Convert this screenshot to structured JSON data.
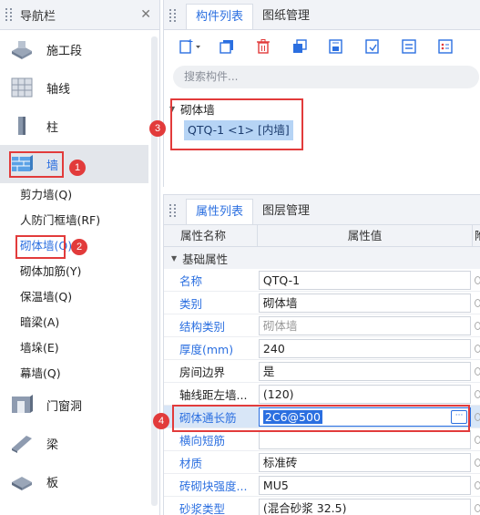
{
  "nav": {
    "title": "导航栏",
    "items": [
      {
        "label": "施工段",
        "icon": "construction-stage-icon"
      },
      {
        "label": "轴线",
        "icon": "axis-grid-icon"
      },
      {
        "label": "柱",
        "icon": "column-icon"
      },
      {
        "label": "墙",
        "icon": "wall-icon"
      },
      {
        "label": "门窗洞",
        "icon": "door-window-icon"
      },
      {
        "label": "梁",
        "icon": "beam-icon"
      },
      {
        "label": "板",
        "icon": "slab-icon"
      }
    ],
    "sub_items": [
      "剪力墙(Q)",
      "人防门框墙(RF)",
      "砌体墙(Q)",
      "砌体加筋(Y)",
      "保温墙(Q)",
      "暗梁(A)",
      "墙垛(E)",
      "幕墙(Q)"
    ]
  },
  "component_panel": {
    "tabs": [
      "构件列表",
      "图纸管理"
    ],
    "search_placeholder": "搜索构件...",
    "tree_root": "砌体墙",
    "tree_child": "QTQ-1 <1> [内墙]"
  },
  "property_panel": {
    "tabs": [
      "属性列表",
      "图层管理"
    ],
    "col_name": "属性名称",
    "col_value": "属性值",
    "col_attach": "附",
    "group": "基础属性",
    "rows": [
      {
        "name": "名称",
        "value": "QTQ-1"
      },
      {
        "name": "类别",
        "value": "砌体墙"
      },
      {
        "name": "结构类别",
        "value": "砌体墙"
      },
      {
        "name": "厚度(mm)",
        "value": "240"
      },
      {
        "name": "房间边界",
        "value": "是"
      },
      {
        "name": "轴线距左墙...",
        "value": "(120)"
      },
      {
        "name": "砌体通长筋",
        "value": "2C6@500"
      },
      {
        "name": "横向短筋",
        "value": ""
      },
      {
        "name": "材质",
        "value": "标准砖"
      },
      {
        "name": "砖砌块强度...",
        "value": "MU5"
      },
      {
        "name": "砂浆类型",
        "value": "(混合砂浆  32.5)"
      }
    ]
  },
  "annotations": [
    "1",
    "2",
    "3",
    "4"
  ],
  "colors": {
    "accent": "#2b6fe0",
    "annotation": "#e23b3b",
    "selection": "#b6d4f5"
  }
}
